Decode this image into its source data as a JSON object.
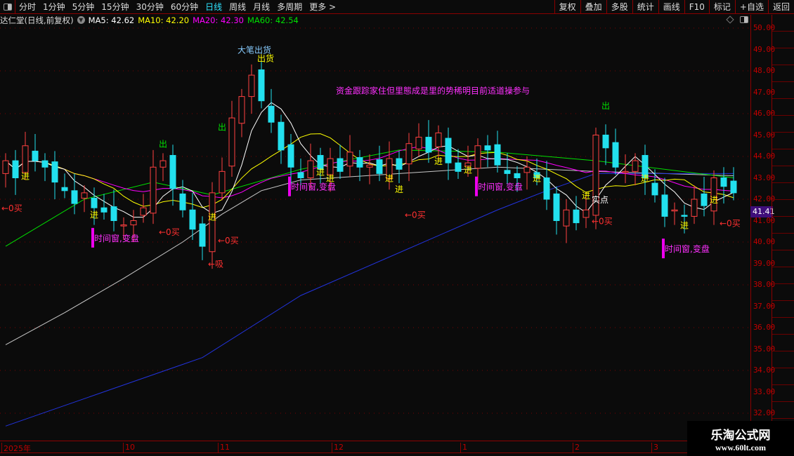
{
  "toolbar": {
    "periods": [
      "分时",
      "1分钟",
      "5分钟",
      "15分钟",
      "30分钟",
      "60分钟",
      "日线",
      "周线",
      "月线",
      "多周期",
      "更多 >"
    ],
    "active_period": "日线",
    "buttons": [
      "复权",
      "叠加",
      "多股",
      "统计",
      "画线",
      "F10",
      "标记",
      "+自选",
      "返回"
    ]
  },
  "info": {
    "title": "达仁堂(日线,前复权)",
    "ma5": "MA5: 42.62",
    "ma10": "MA10: 42.20",
    "ma20": "MA20: 42.30",
    "ma60": "MA60: 42.54"
  },
  "colors": {
    "up": "#ff4040",
    "down": "#22e0ee",
    "ma5": "#ffffff",
    "ma10": "#ffff00",
    "ma20": "#ff00ff",
    "ma60": "#00e000",
    "long_white": "#c8c8c8",
    "long_blue": "#2233dd",
    "axis": "#c00000"
  },
  "price_tag": "41.41",
  "date_axis": [
    "2025年",
    "10",
    "11",
    "12",
    "1",
    "2",
    "3"
  ],
  "watermark": {
    "line1": "乐淘公式网",
    "line2": "www.60lt.com"
  },
  "chart_data": {
    "type": "candlestick",
    "ylim": [
      32,
      50
    ],
    "y_ticks": [
      "32.00",
      "33.00",
      "34.00",
      "35.00",
      "36.00",
      "37.00",
      "38.00",
      "39.00",
      "40.00",
      "41.00",
      "42.00",
      "43.00",
      "44.00",
      "45.00",
      "46.00",
      "47.00",
      "48.00",
      "49.00",
      "50.00"
    ],
    "grid": "dotted every 2.00",
    "close": [
      43.8,
      43.0,
      44.5,
      43.8,
      43.5,
      42.8,
      42.4,
      41.8,
      42.3,
      41.6,
      41.4,
      41.0,
      40.8,
      41.0,
      41.6,
      43.5,
      43.8,
      42.5,
      41.5,
      40.6,
      39.8,
      42.3,
      43.3,
      45.8,
      46.8,
      47.8,
      46.6,
      45.6,
      44.3,
      43.5,
      43.0,
      43.8,
      43.4,
      43.9,
      43.3,
      44.2,
      43.5,
      43.6,
      43.2,
      43.9,
      43.4,
      44.6,
      44.9,
      44.2,
      45.1,
      43.7,
      43.3,
      43.7,
      44.5,
      44.3,
      43.6,
      43.2,
      43.0,
      43.5,
      43.0,
      42.0,
      41.0,
      41.5,
      40.9,
      41.5,
      45.0,
      44.4,
      43.5,
      43.3,
      43.8,
      43.0,
      42.2,
      41.2,
      41.5,
      41.2,
      42.0,
      41.7,
      43.0,
      42.6,
      42.3
    ],
    "long_lines": [
      {
        "color": "long_white",
        "points": [
          [
            0,
            35.2
          ],
          [
            6,
            36.7
          ],
          [
            12,
            38.3
          ],
          [
            18,
            40.0
          ],
          [
            22,
            41.3
          ],
          [
            26,
            42.4
          ],
          [
            30,
            42.9
          ],
          [
            40,
            43.2
          ],
          [
            50,
            43.5
          ],
          [
            60,
            43.3
          ],
          [
            74,
            43.1
          ]
        ]
      },
      {
        "color": "long_blue",
        "points": [
          [
            0,
            31.4
          ],
          [
            10,
            33.0
          ],
          [
            20,
            34.6
          ],
          [
            30,
            37.5
          ],
          [
            40,
            39.5
          ],
          [
            50,
            41.5
          ],
          [
            55,
            42.4
          ],
          [
            60,
            43.2
          ],
          [
            74,
            43.2
          ]
        ]
      },
      {
        "color": "ma60",
        "points": [
          [
            0,
            39.8
          ],
          [
            8,
            42.0
          ],
          [
            15,
            42.8
          ],
          [
            21,
            42.2
          ],
          [
            30,
            43.4
          ],
          [
            40,
            44.3
          ],
          [
            50,
            44.2
          ],
          [
            60,
            43.8
          ],
          [
            74,
            43.0
          ]
        ]
      }
    ],
    "annotations": [
      {
        "text": "大笔出货",
        "i": 24,
        "price": 49.0,
        "color": "#88ccff"
      },
      {
        "text": "出货",
        "i": 26,
        "price": 48.6,
        "color": "#ffff00"
      },
      {
        "text": "出",
        "i": 16,
        "price": 44.6,
        "color": "#00e000"
      },
      {
        "text": "出",
        "i": 22,
        "price": 45.4,
        "color": "#00e000"
      },
      {
        "text": "出",
        "i": 61,
        "price": 46.4,
        "color": "#00e000"
      },
      {
        "text": "进",
        "i": 2,
        "price": 43.1,
        "color": "#ffff00"
      },
      {
        "text": "进",
        "i": 9,
        "price": 41.3,
        "color": "#ffff00"
      },
      {
        "text": "进",
        "i": 21,
        "price": 41.2,
        "color": "#ffff00"
      },
      {
        "text": "进",
        "i": 32,
        "price": 43.3,
        "color": "#ffff00"
      },
      {
        "text": "进",
        "i": 33,
        "price": 43.0,
        "color": "#ffff00"
      },
      {
        "text": "进",
        "i": 39,
        "price": 43.0,
        "color": "#ffff00"
      },
      {
        "text": "进",
        "i": 40,
        "price": 42.5,
        "color": "#ffff00"
      },
      {
        "text": "进",
        "i": 44,
        "price": 43.8,
        "color": "#ffff00"
      },
      {
        "text": "进",
        "i": 47,
        "price": 43.4,
        "color": "#ffff00"
      },
      {
        "text": "进",
        "i": 54,
        "price": 43.0,
        "color": "#ffff00"
      },
      {
        "text": "进",
        "i": 59,
        "price": 42.2,
        "color": "#ffff00"
      },
      {
        "text": "进",
        "i": 65,
        "price": 43.0,
        "color": "#ffff00"
      },
      {
        "text": "进",
        "i": 69,
        "price": 40.8,
        "color": "#ffff00"
      },
      {
        "text": "进",
        "i": 72,
        "price": 42.0,
        "color": "#ffff00"
      },
      {
        "text": "←0买",
        "i": 0,
        "price": 41.6,
        "color": "#ff3030"
      },
      {
        "text": "←0买",
        "i": 16,
        "price": 40.5,
        "color": "#ff3030"
      },
      {
        "text": "←0买",
        "i": 22,
        "price": 40.1,
        "color": "#ff3030"
      },
      {
        "text": "←0买",
        "i": 41,
        "price": 41.3,
        "color": "#ff3030"
      },
      {
        "text": "←0买",
        "i": 60,
        "price": 41.0,
        "color": "#ff3030"
      },
      {
        "text": "←0买",
        "i": 73,
        "price": 40.9,
        "color": "#ff3030"
      },
      {
        "text": "←吸",
        "i": 21,
        "price": 39.0,
        "color": "#ff3030"
      },
      {
        "text": "实点",
        "i": 60,
        "price": 42.0,
        "color": "#ffffff"
      },
      {
        "text": "时间窗,变盘",
        "i": 9,
        "price": 40.2,
        "color": "#ff30ff",
        "bar": true
      },
      {
        "text": "时间窗,变盘",
        "i": 29,
        "price": 42.6,
        "color": "#ff30ff",
        "bar": true
      },
      {
        "text": "时间窗,变盘",
        "i": 48,
        "price": 42.6,
        "color": "#ff30ff",
        "bar": true
      },
      {
        "text": "时间窗,变盘",
        "i": 67,
        "price": 39.7,
        "color": "#ff30ff",
        "bar": true
      },
      {
        "text": "资金跟踪家住但里態成是里的势稀明目前适道操参与",
        "i": 34,
        "price": 47.1,
        "color": "#ff30ff"
      }
    ]
  }
}
